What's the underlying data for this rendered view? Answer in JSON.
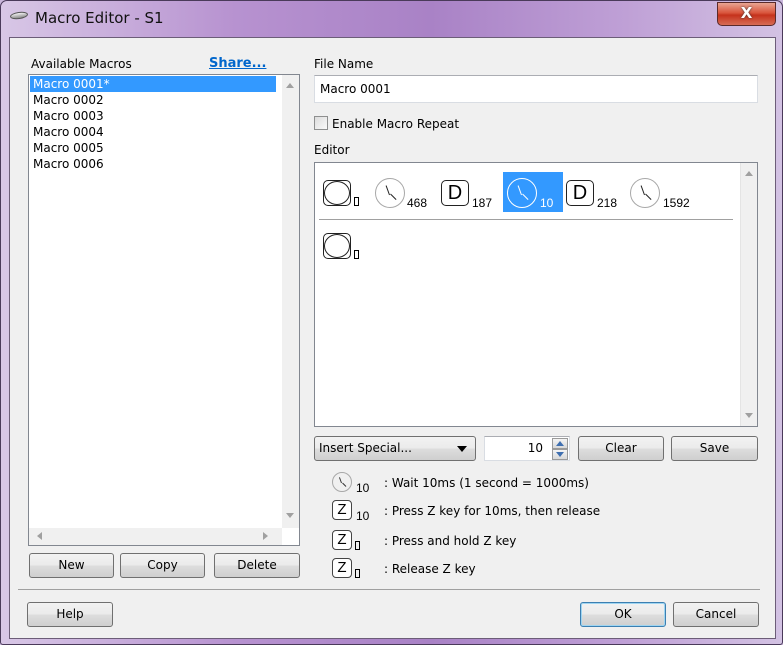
{
  "window": {
    "title": "Macro Editor - S1",
    "close_label": "X"
  },
  "macros_panel": {
    "label": "Available Macros",
    "share_link": "Share...",
    "items": [
      {
        "label": "Macro 0001*",
        "selected": true
      },
      {
        "label": "Macro 0002",
        "selected": false
      },
      {
        "label": "Macro 0003",
        "selected": false
      },
      {
        "label": "Macro 0004",
        "selected": false
      },
      {
        "label": "Macro 0005",
        "selected": false
      },
      {
        "label": "Macro 0006",
        "selected": false
      }
    ],
    "buttons": {
      "new": "New",
      "copy": "Copy",
      "delete": "Delete"
    }
  },
  "file": {
    "label": "File Name",
    "value": "Macro 0001"
  },
  "repeat": {
    "label": "Enable Macro Repeat",
    "checked": false
  },
  "editor": {
    "label": "Editor",
    "rows": [
      {
        "tokens": [
          {
            "type": "mouse-button",
            "icon": "mouse-button-icon",
            "suffix": "▯",
            "selected": false
          },
          {
            "type": "wait",
            "icon": "clock-icon",
            "suffix": "468",
            "selected": false
          },
          {
            "type": "key-press",
            "icon": "keycap-icon",
            "key": "D",
            "suffix": "187",
            "selected": false
          },
          {
            "type": "wait",
            "icon": "clock-icon",
            "suffix": "10",
            "selected": true
          },
          {
            "type": "key-press",
            "icon": "keycap-icon",
            "key": "D",
            "suffix": "218",
            "selected": false
          },
          {
            "type": "wait",
            "icon": "clock-icon",
            "suffix": "1592",
            "selected": false
          }
        ]
      },
      {
        "tokens": [
          {
            "type": "mouse-button",
            "icon": "mouse-button-icon",
            "suffix": "▯",
            "selected": false
          }
        ]
      }
    ]
  },
  "controls": {
    "insert_special": "Insert Special...",
    "spin_value": "10",
    "clear": "Clear",
    "save": "Save"
  },
  "legend": [
    {
      "icon": "clock-icon",
      "key": "",
      "sub": "10",
      "text": ": Wait 10ms (1 second = 1000ms)"
    },
    {
      "icon": "keycap-icon",
      "key": "Z",
      "sub": "10",
      "text": ": Press Z key for 10ms, then release"
    },
    {
      "icon": "keycap-icon",
      "key": "Z",
      "sub": "▯",
      "text": ": Press and hold Z key"
    },
    {
      "icon": "keycap-icon",
      "key": "Z",
      "sub": "▯",
      "text": ": Release Z key"
    }
  ],
  "footer": {
    "help": "Help",
    "ok": "OK",
    "cancel": "Cancel"
  },
  "colors": {
    "selection": "#3399ff",
    "link": "#0066cc",
    "close_button": "#c5321c"
  }
}
